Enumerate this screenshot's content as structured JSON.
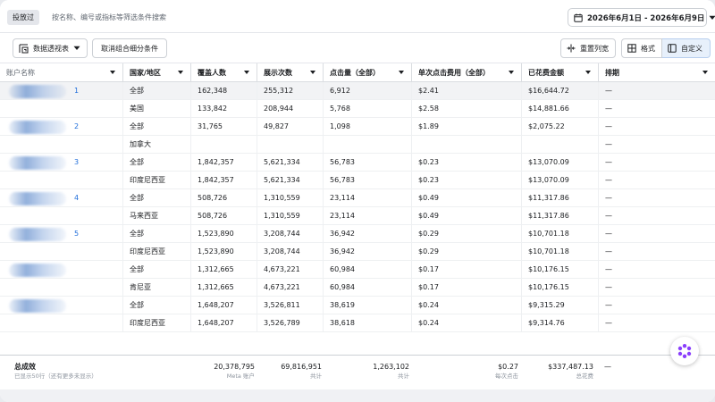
{
  "topbar": {
    "chip_label": "投放过",
    "search_placeholder": "按名称、编号或指标等筛选条件搜索",
    "date_range": "2026年6月1日 - 2026年6月9日"
  },
  "toolbar": {
    "pivot_label": "数据透视表",
    "clear_breakdown_label": "取消组合细分条件",
    "reset_columns_label": "重置列宽",
    "format_label": "格式",
    "customize_label": "自定义"
  },
  "table": {
    "columns": [
      "账户名称",
      "国家/地区",
      "覆盖人数",
      "展示次数",
      "点击量（全部）",
      "单次点击费用（全部）",
      "已花费金额",
      "排期"
    ],
    "rows": [
      {
        "account": "1",
        "country": "全部",
        "reach": "162,348",
        "impressions": "255,312",
        "clicks": "6,912",
        "cpc": "$2.41",
        "spent": "$16,644.72",
        "schedule": "—"
      },
      {
        "account": "",
        "country": "美国",
        "reach": "133,842",
        "impressions": "208,944",
        "clicks": "5,768",
        "cpc": "$2.58",
        "spent": "$14,881.66",
        "schedule": "—"
      },
      {
        "account": "2",
        "country": "全部",
        "reach": "31,765",
        "impressions": "49,827",
        "clicks": "1,098",
        "cpc": "$1.89",
        "spent": "$2,075.22",
        "schedule": "—"
      },
      {
        "account": "",
        "country": "加拿大",
        "reach": "",
        "impressions": "",
        "clicks": "",
        "cpc": "",
        "spent": "",
        "schedule": "—"
      },
      {
        "account": "3",
        "country": "全部",
        "reach": "1,842,357",
        "impressions": "5,621,334",
        "clicks": "56,783",
        "cpc": "$0.23",
        "spent": "$13,070.09",
        "schedule": "—"
      },
      {
        "account": "",
        "country": "印度尼西亚",
        "reach": "1,842,357",
        "impressions": "5,621,334",
        "clicks": "56,783",
        "cpc": "$0.23",
        "spent": "$13,070.09",
        "schedule": "—"
      },
      {
        "account": "4",
        "country": "全部",
        "reach": "508,726",
        "impressions": "1,310,559",
        "clicks": "23,114",
        "cpc": "$0.49",
        "spent": "$11,317.86",
        "schedule": "—"
      },
      {
        "account": "",
        "country": "马来西亚",
        "reach": "508,726",
        "impressions": "1,310,559",
        "clicks": "23,114",
        "cpc": "$0.49",
        "spent": "$11,317.86",
        "schedule": "—"
      },
      {
        "account": "5",
        "country": "全部",
        "reach": "1,523,890",
        "impressions": "3,208,744",
        "clicks": "36,942",
        "cpc": "$0.29",
        "spent": "$10,701.18",
        "schedule": "—"
      },
      {
        "account": "",
        "country": "印度尼西亚",
        "reach": "1,523,890",
        "impressions": "3,208,744",
        "clicks": "36,942",
        "cpc": "$0.29",
        "spent": "$10,701.18",
        "schedule": "—"
      },
      {
        "account": "",
        "country": "全部",
        "reach": "1,312,665",
        "impressions": "4,673,221",
        "clicks": "60,984",
        "cpc": "$0.17",
        "spent": "$10,176.15",
        "schedule": "—"
      },
      {
        "account": "",
        "country": "肯尼亚",
        "reach": "1,312,665",
        "impressions": "4,673,221",
        "clicks": "60,984",
        "cpc": "$0.17",
        "spent": "$10,176.15",
        "schedule": "—"
      },
      {
        "account": "",
        "country": "全部",
        "reach": "1,648,207",
        "impressions": "3,526,811",
        "clicks": "38,619",
        "cpc": "$0.24",
        "spent": "$9,315.29",
        "schedule": "—"
      },
      {
        "account": "",
        "country": "印度尼西亚",
        "reach": "1,648,207",
        "impressions": "3,526,789",
        "clicks": "38,618",
        "cpc": "$0.24",
        "spent": "$9,314.76",
        "schedule": "—"
      }
    ]
  },
  "footer": {
    "title": "总成效",
    "subtitle": "已显示50行（还有更多未显示）",
    "reach": "20,378,795",
    "reach_sub": "Meta 账户",
    "impressions": "69,816,951",
    "impressions_sub": "共计",
    "clicks": "1,263,102",
    "clicks_sub": "共计",
    "cpc": "$0.27",
    "cpc_sub": "每次点击",
    "spent": "$337,487.13",
    "spent_sub": "总花费",
    "schedule": "—"
  },
  "colors": {
    "accent": "#216fdb",
    "border": "#ccd0d5",
    "highlight_row": "#f2f3f5"
  },
  "icons": [
    "calendar-icon",
    "chevron-down-icon",
    "pivot-table-icon",
    "resize-columns-icon",
    "format-grid-icon",
    "customize-panel-icon",
    "assistant-flower-icon"
  ]
}
